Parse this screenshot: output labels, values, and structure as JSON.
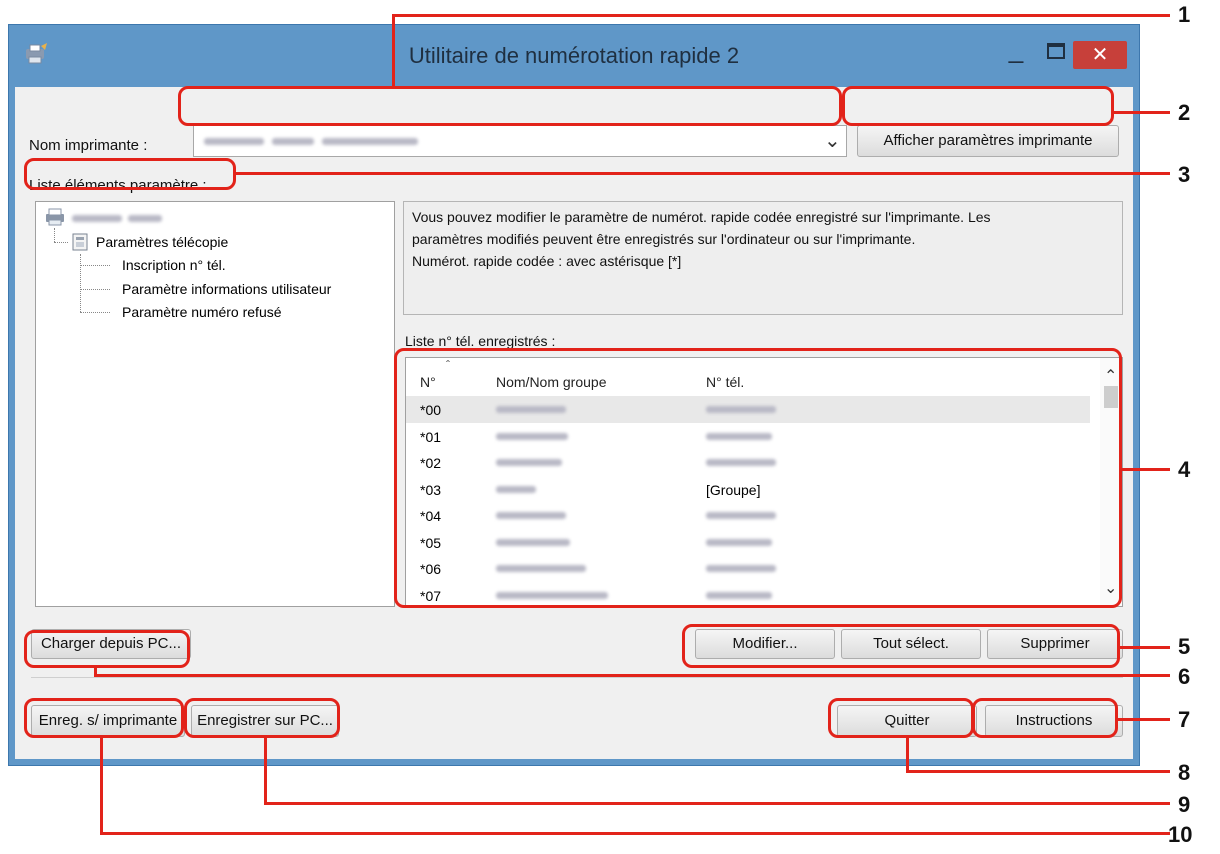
{
  "window": {
    "title": "Utilitaire de numérotation rapide 2",
    "min_icon": "minimize-icon",
    "max_icon": "maximize-icon",
    "close_icon": "close-icon",
    "close_glyph": "✕"
  },
  "printer": {
    "label": "Nom imprimante :",
    "dropdown_icon": "chevron-down-icon",
    "dropdown_glyph": "⌄",
    "show_settings_button": "Afficher paramètres imprimante"
  },
  "settings_list": {
    "label": "Liste éléments paramètre :",
    "tree": {
      "fax_settings": "Paramètres télécopie",
      "items": [
        "Inscription n° tél.",
        "Paramètre informations utilisateur",
        "Paramètre numéro refusé"
      ]
    }
  },
  "description": {
    "lines": [
      "Vous pouvez modifier le paramètre de numérot. rapide codée enregistré sur l'imprimante. Les",
      "paramètres modifiés peuvent être enregistrés sur l'ordinateur ou sur l'imprimante.",
      "Numérot. rapide codée : avec astérisque [*]"
    ]
  },
  "registered_list": {
    "label": "Liste n° tél. enregistrés :",
    "columns": [
      "N°",
      "Nom/Nom groupe",
      "N° tél."
    ],
    "sort_glyph": "ˆ",
    "scroll_up_glyph": "⌃",
    "scroll_down_glyph": "⌄",
    "rows": [
      {
        "no": "*00",
        "tel": ""
      },
      {
        "no": "*01",
        "tel": ""
      },
      {
        "no": "*02",
        "tel": ""
      },
      {
        "no": "*03",
        "tel": "[Groupe]"
      },
      {
        "no": "*04",
        "tel": ""
      },
      {
        "no": "*05",
        "tel": ""
      },
      {
        "no": "*06",
        "tel": ""
      },
      {
        "no": "*07",
        "tel": ""
      }
    ]
  },
  "buttons": {
    "load_from_pc": "Charger depuis PC...",
    "edit": "Modifier...",
    "select_all": "Tout sélect.",
    "delete": "Supprimer",
    "save_to_printer": "Enreg. s/ imprimante",
    "save_to_pc": "Enregistrer sur PC...",
    "quit": "Quitter",
    "instructions": "Instructions"
  },
  "callouts": [
    "1",
    "2",
    "3",
    "4",
    "5",
    "6",
    "7",
    "8",
    "9",
    "10"
  ],
  "colors": {
    "callout_red": "#e2231a",
    "window_frame": "#5f97c8",
    "close_red": "#c7403a"
  }
}
